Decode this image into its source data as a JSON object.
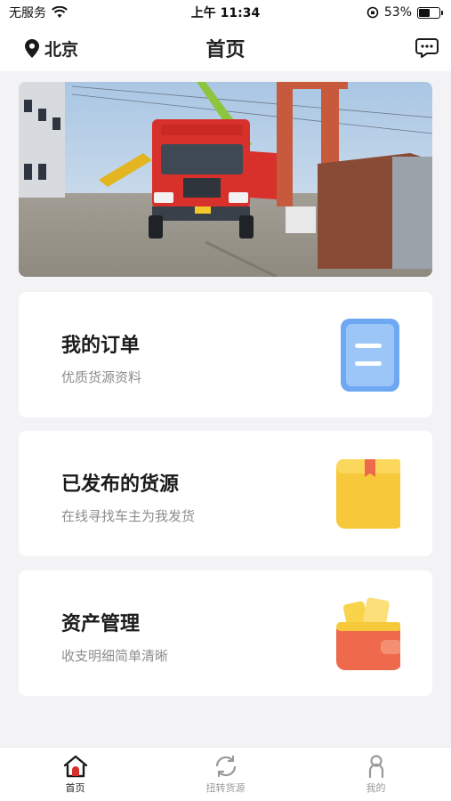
{
  "status_bar": {
    "carrier": "无服务",
    "time": "上午 11:34",
    "battery": "53%",
    "battery_level": 0.53
  },
  "nav": {
    "location": "北京",
    "title": "首页"
  },
  "cards": [
    {
      "title": "我的订单",
      "subtitle": "优质货源资料",
      "icon": "document-icon"
    },
    {
      "title": "已发布的货源",
      "subtitle": "在线寻找车主为我发货",
      "icon": "package-icon"
    },
    {
      "title": "资产管理",
      "subtitle": "收支明细简单清晰",
      "icon": "wallet-icon"
    }
  ],
  "tabs": [
    {
      "label": "首页",
      "icon": "home-icon",
      "active": true
    },
    {
      "label": "扭转货源",
      "icon": "refresh-icon",
      "active": false
    },
    {
      "label": "我的",
      "icon": "person-icon",
      "active": false
    }
  ],
  "colors": {
    "background": "#f3f3f5",
    "card": "#ffffff",
    "truck_red": "#d8312b",
    "document_blue": "#6fa8f2",
    "package_yellow": "#f7c83a",
    "wallet_orange": "#ef6a4c"
  }
}
